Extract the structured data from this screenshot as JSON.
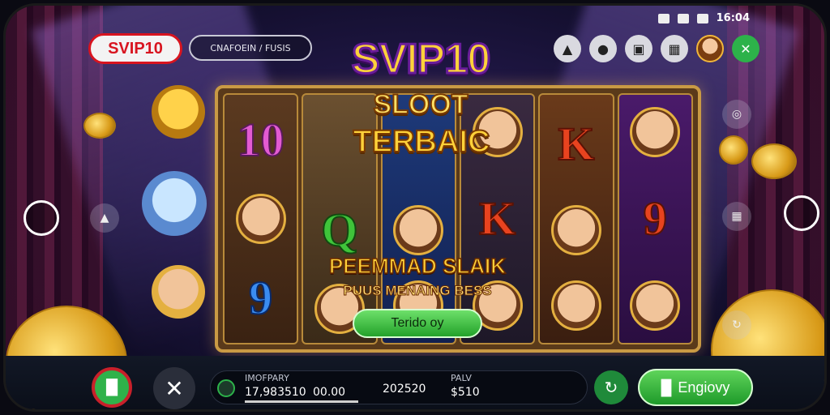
{
  "status": {
    "time": "16:04"
  },
  "topbar": {
    "brand": "SVIP10",
    "mode": "CNAFOEIN / FUSIS"
  },
  "title": {
    "line1": "SVIP10",
    "line2": "SLOOT",
    "line3": "TERBAIC"
  },
  "reels": [
    [
      "10",
      "jester",
      "9"
    ],
    [
      "Q-top",
      "Q",
      "creature"
    ],
    [
      "",
      "princess",
      "character"
    ],
    [
      "idol",
      "K",
      "bull"
    ],
    [
      "K",
      "",
      "deer"
    ],
    [
      "coin",
      "9",
      "girl"
    ]
  ],
  "reel_symbols": {
    "r1_top": "10",
    "r1_bot": "9",
    "r2_mid": "Q",
    "r4_mid": "K",
    "r5_top": "K",
    "r6_mid": "9"
  },
  "promo": {
    "headline": "PEEMMAD SLAIK",
    "sub": "PUUS MENAING BESS",
    "cta": "Terido oy"
  },
  "bottom": {
    "label1": "IMOFPARY",
    "value1": "17,983510",
    "value2": "00.00",
    "value3": "202520",
    "label4": "PALV",
    "value4": "$510",
    "play_label": "Engiovy"
  },
  "icons": {
    "top": [
      "bell-icon",
      "chat-icon",
      "film-icon",
      "gift-icon",
      "avatar",
      "close-icon"
    ]
  }
}
